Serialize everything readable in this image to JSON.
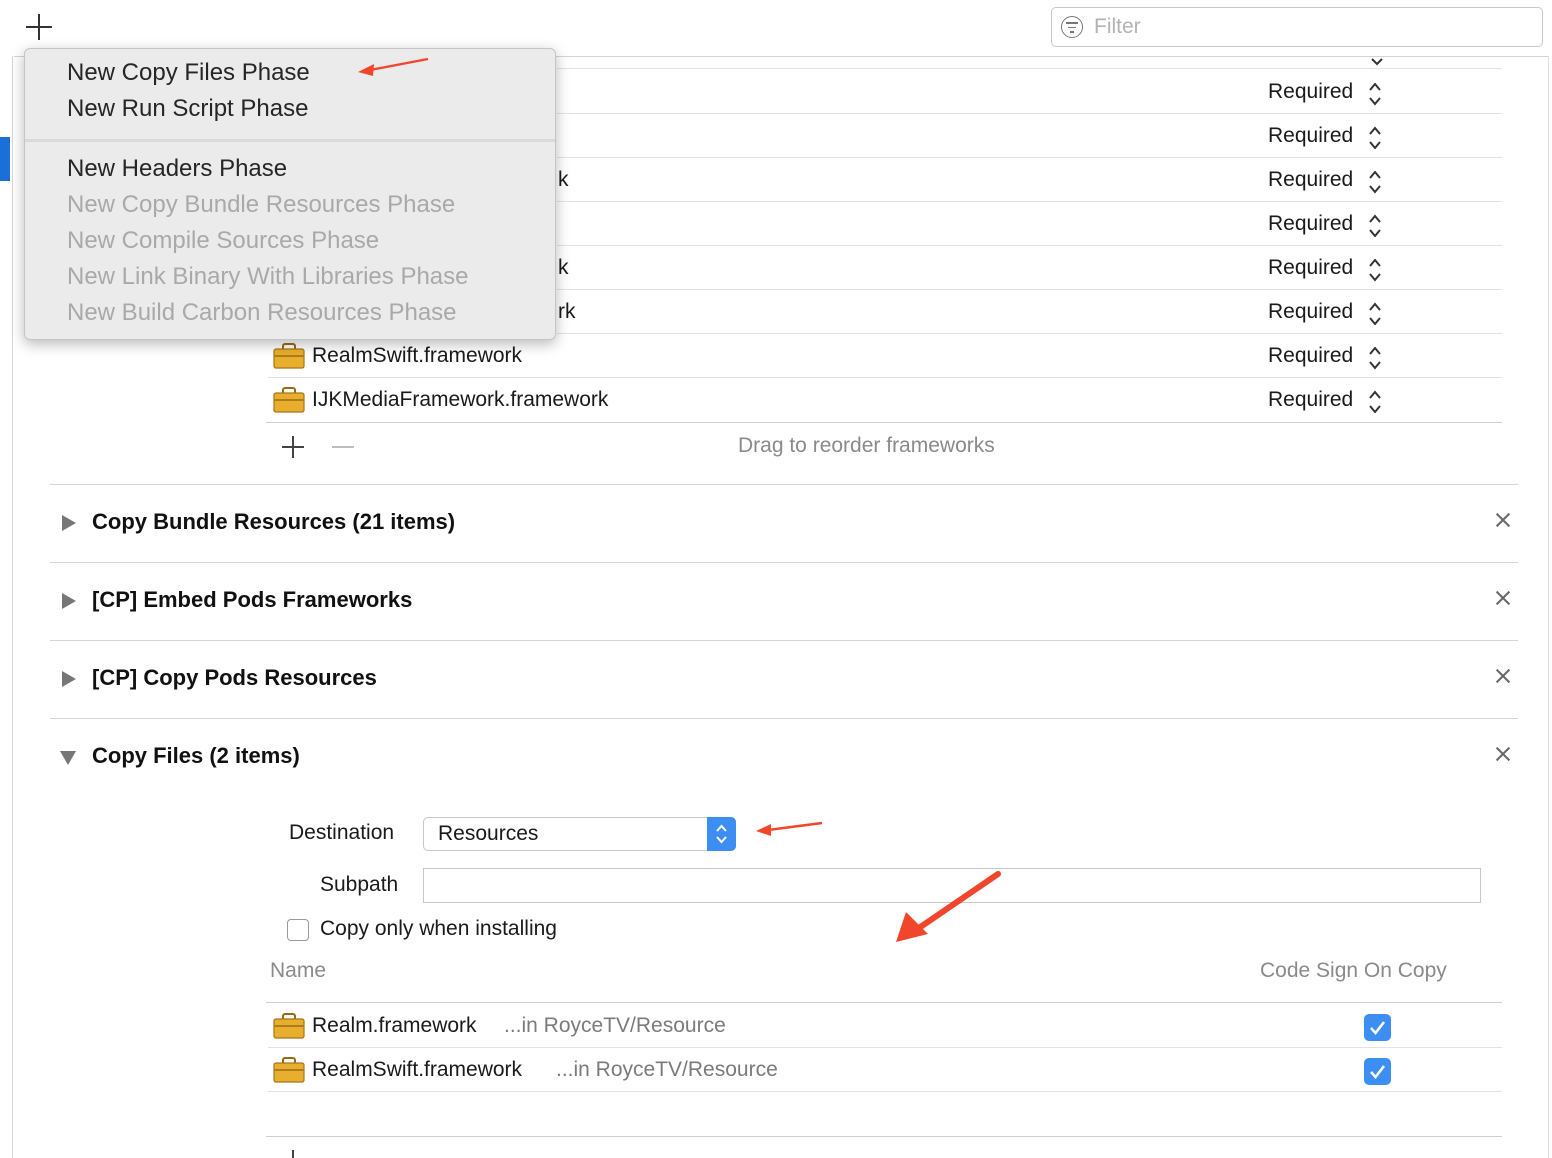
{
  "toolbar": {
    "add_icon": "plus-icon"
  },
  "filter": {
    "placeholder": "Filter",
    "icon": "filter-icon"
  },
  "add_menu": {
    "items": [
      {
        "label": "New Copy Files Phase",
        "enabled": true
      },
      {
        "label": "New Run Script Phase",
        "enabled": true
      },
      {
        "label": "New Headers Phase",
        "enabled": true
      },
      {
        "label": "New Copy Bundle Resources Phase",
        "enabled": false
      },
      {
        "label": "New Compile Sources Phase",
        "enabled": false
      },
      {
        "label": "New Link Binary With Libraries Phase",
        "enabled": false
      },
      {
        "label": "New Build Carbon Resources Phase",
        "enabled": false
      }
    ]
  },
  "link_libraries": {
    "rows": [
      {
        "name_fragment": "",
        "status": "Required"
      },
      {
        "name_fragment": "",
        "status": "Required"
      },
      {
        "name_fragment": "k",
        "status": "Required"
      },
      {
        "name_fragment": "",
        "status": "Required"
      },
      {
        "name_fragment": "k",
        "status": "Required"
      },
      {
        "name_fragment": "rk",
        "status": "Required"
      },
      {
        "name": "RealmSwift.framework",
        "status": "Required"
      },
      {
        "name": "IJKMediaFramework.framework",
        "status": "Required"
      }
    ],
    "drag_hint": "Drag to reorder frameworks"
  },
  "phases": [
    {
      "title": "Copy Bundle Resources (21 items)",
      "expanded": false
    },
    {
      "title": "[CP] Embed Pods Frameworks",
      "expanded": false
    },
    {
      "title": "[CP] Copy Pods Resources",
      "expanded": false
    },
    {
      "title": "Copy Files (2 items)",
      "expanded": true
    }
  ],
  "copy_files": {
    "destination_label": "Destination",
    "destination_value": "Resources",
    "subpath_label": "Subpath",
    "subpath_value": "",
    "copy_only_label": "Copy only when installing",
    "copy_only_checked": false,
    "col_name": "Name",
    "col_code_sign": "Code Sign On Copy",
    "files": [
      {
        "name": "Realm.framework",
        "location": "...in RoyceTV/Resource",
        "code_sign": true
      },
      {
        "name": "RealmSwift.framework",
        "location": "...in RoyceTV/Resource",
        "code_sign": true
      }
    ]
  },
  "colors": {
    "accent": "#3d8ef3",
    "annotation_arrow": "#f0462c",
    "sidebar_selected": "#1b6fd9"
  }
}
